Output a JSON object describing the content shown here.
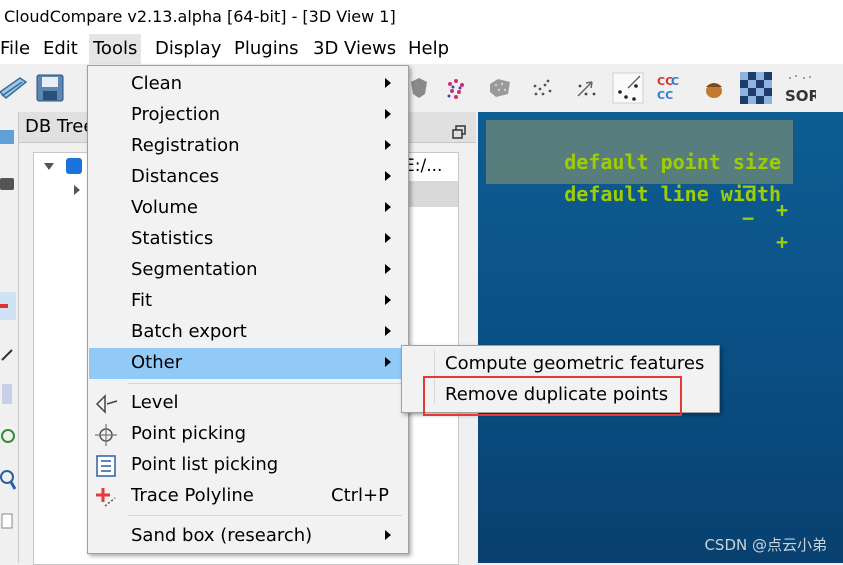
{
  "window": {
    "title": "CloudCompare v2.13.alpha [64-bit] - [3D View 1]"
  },
  "menubar": {
    "items": [
      "File",
      "Edit",
      "Tools",
      "Display",
      "Plugins",
      "3D Views",
      "Help"
    ]
  },
  "toolbar": {
    "icons": [
      "open-icon",
      "save-icon",
      "shield-icon",
      "color-points-icon",
      "gray-cloud-icon",
      "scatter-points-icon",
      "arrow-points-icon",
      "sparse-points-icon",
      "ccc-icon",
      "acorn-icon",
      "checkerboard-icon",
      "sor-icon"
    ],
    "ccc_text": "CC",
    "sor_text": "SOR"
  },
  "db_tree": {
    "title": "DB Tree",
    "item_text": "E:/..."
  },
  "view3d": {
    "point_size_label": "default point size",
    "line_width_label": "default line width",
    "minus": "−",
    "plus": "+"
  },
  "tools_menu": {
    "items": [
      "Clean",
      "Projection",
      "Registration",
      "Distances",
      "Volume",
      "Statistics",
      "Segmentation",
      "Fit",
      "Batch export",
      "Other"
    ],
    "highlighted": "Other",
    "tool_items": [
      "Level",
      "Point picking",
      "Point list picking",
      "Trace Polyline"
    ],
    "trace_shortcut": "Ctrl+P",
    "sandbox": "Sand box (research)"
  },
  "other_submenu": {
    "items": [
      "Compute geometric features",
      "Remove duplicate points"
    ],
    "highlighted": "Remove duplicate points"
  },
  "watermark": "CSDN @点云小弟",
  "colors": {
    "highlight": "#91c9f7",
    "overlay_text": "#a6d400",
    "view_bg": "#0e5d93",
    "annotation_box": "#e53935"
  }
}
